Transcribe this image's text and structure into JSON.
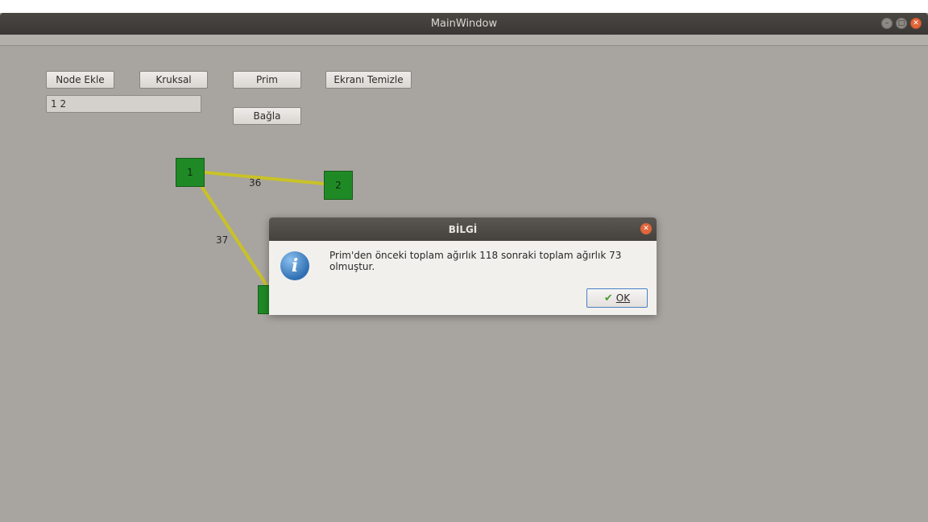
{
  "window": {
    "title": "MainWindow",
    "controls": [
      "minimize-icon",
      "maximize-icon",
      "close-icon"
    ]
  },
  "toolbar": {
    "node_ekle": "Node Ekle",
    "kruksal": "Kruksal",
    "prim": "Prim",
    "ekrani_temizle": "Ekranı Temizle",
    "bagla": "Bağla"
  },
  "input": {
    "value": "1 2"
  },
  "graph": {
    "nodes": [
      "1",
      "2"
    ],
    "edges": [
      {
        "from": "1",
        "to": "2",
        "weight": "36"
      },
      {
        "from": "1",
        "to": "3",
        "weight": "37"
      }
    ],
    "edge_color": "#c9c227",
    "node_color": "#1f8a25"
  },
  "dialog": {
    "title": "BİLGİ",
    "message": "Prim'den önceki toplam ağırlık 118 sonraki toplam ağırlık 73 olmuştur.",
    "ok_label": "OK",
    "icon": "info-icon"
  }
}
